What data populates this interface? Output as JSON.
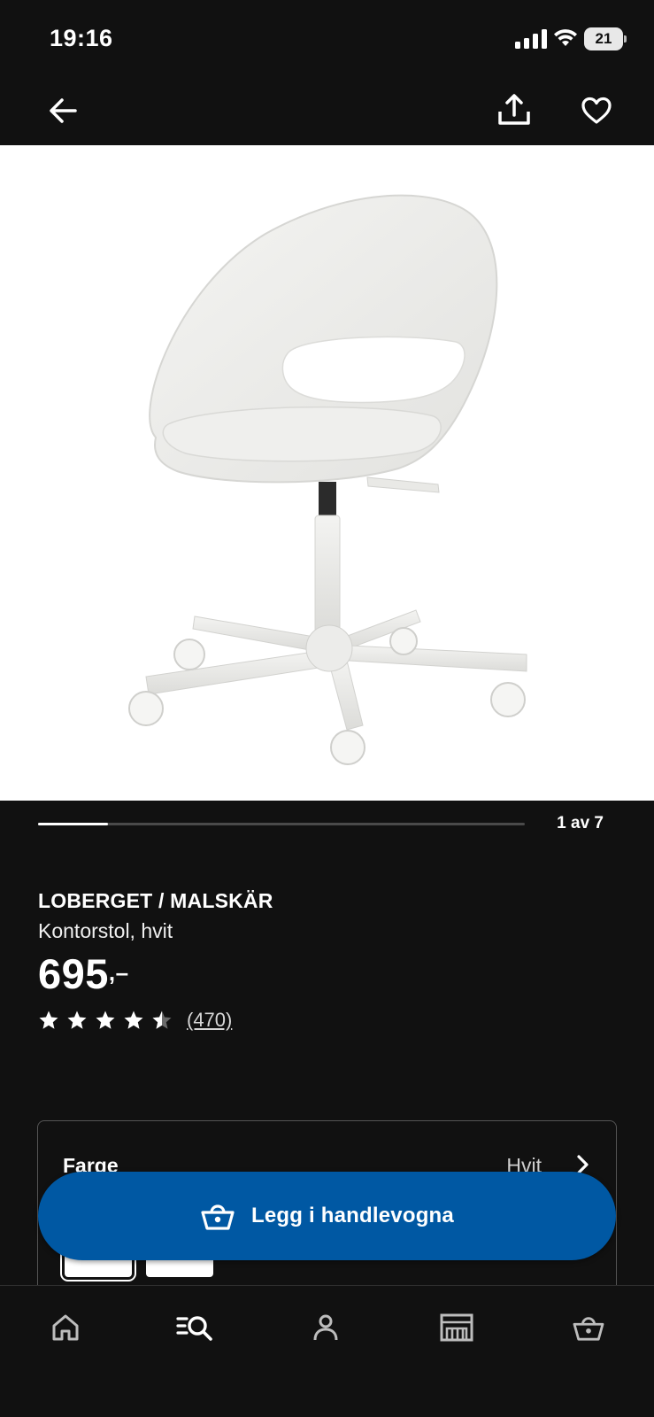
{
  "status_bar": {
    "time": "19:16",
    "battery_level": "21",
    "icons": [
      "signal-icon",
      "wifi-icon",
      "battery-icon"
    ]
  },
  "top_nav": {
    "icons": [
      "back-arrow-icon",
      "share-icon",
      "heart-icon"
    ]
  },
  "gallery": {
    "counter": "1 av 7",
    "current_image": 1,
    "total_images": 7
  },
  "product": {
    "name": "LOBERGET / MALSKÄR",
    "description": "Kontorstol, hvit",
    "price": "695",
    "price_suffix": ",–",
    "rating": 4.5,
    "rating_count": "(470)"
  },
  "options": {
    "label": "Farge",
    "value": "Hvit",
    "swatch_color": "#ffffff"
  },
  "cart_button": {
    "label": "Legg i handlevogna",
    "icon": "basket-icon",
    "color": "#0058a3"
  },
  "bottom_nav": {
    "items": [
      "home-icon",
      "search-icon",
      "profile-icon",
      "store-icon",
      "cart-icon"
    ],
    "active": "search-icon"
  },
  "colors": {
    "background": "#111111",
    "accent": "#0058a3",
    "text": "#ffffff"
  }
}
